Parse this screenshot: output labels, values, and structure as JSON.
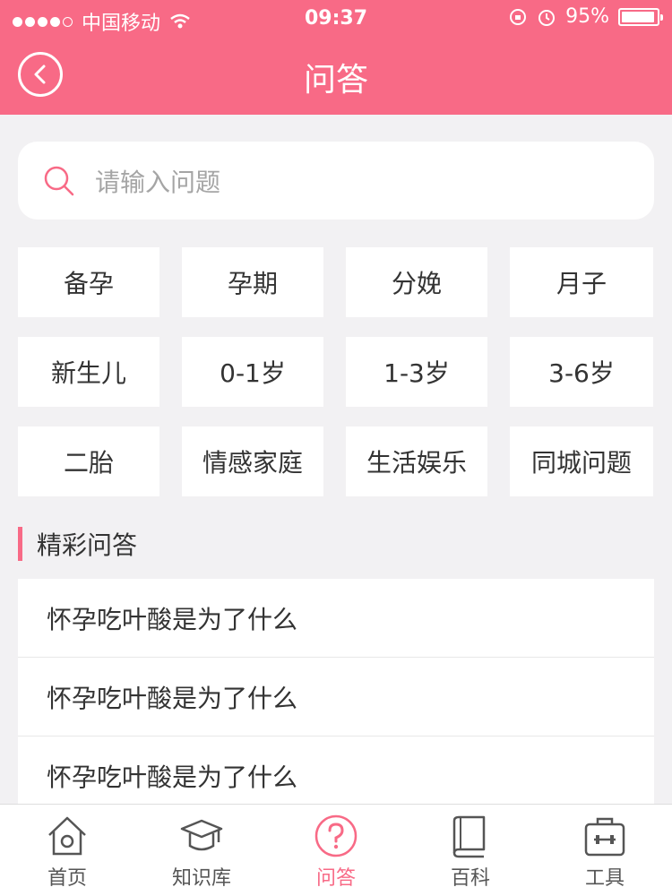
{
  "status_bar": {
    "carrier": "中国移动",
    "time": "09:37",
    "battery": "95%",
    "battery_level": 0.95
  },
  "header": {
    "title": "问答",
    "back_icon": "back-circle-icon",
    "color": "#f86a86"
  },
  "search": {
    "placeholder": "请输入问题",
    "icon": "search-icon"
  },
  "categories": [
    "备孕",
    "孕期",
    "分娩",
    "月子",
    "新生儿",
    "0-1岁",
    "1-3岁",
    "3-6岁",
    "二胎",
    "情感家庭",
    "生活娱乐",
    "同城问题"
  ],
  "section": {
    "title": "精彩问答"
  },
  "questions": [
    "怀孕吃叶酸是为了什么",
    "怀孕吃叶酸是为了什么",
    "怀孕吃叶酸是为了什么"
  ],
  "tabbar": {
    "tabs": [
      {
        "label": "首页",
        "icon": "home-icon"
      },
      {
        "label": "知识库",
        "icon": "graduation-cap-icon"
      },
      {
        "label": "问答",
        "icon": "question-circle-icon"
      },
      {
        "label": "百科",
        "icon": "book-icon"
      },
      {
        "label": "工具",
        "icon": "toolbox-icon"
      }
    ],
    "active_index": 2,
    "active_color": "#f86a86"
  }
}
